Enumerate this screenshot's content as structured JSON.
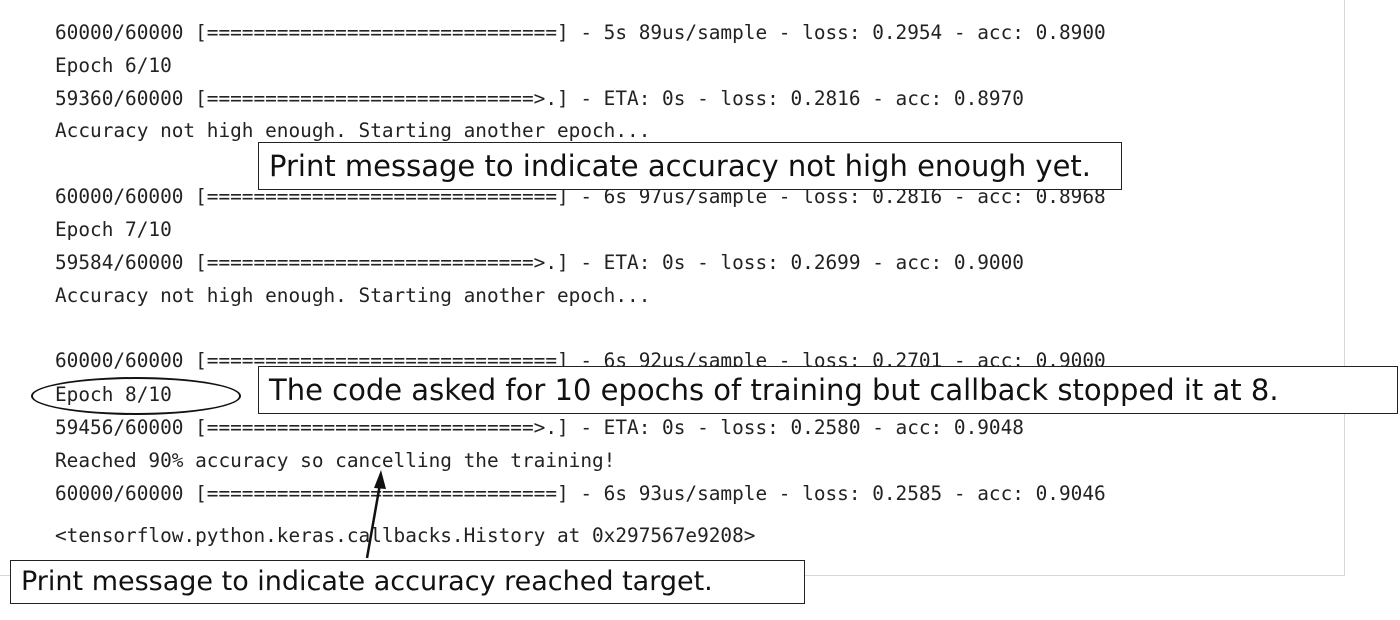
{
  "console": {
    "lines": [
      "60000/60000 [==============================] - 5s 89us/sample - loss: 0.2954 - acc: 0.8900",
      "Epoch 6/10",
      "59360/60000 [============================>.] - ETA: 0s - loss: 0.2816 - acc: 0.8970",
      "Accuracy not high enough. Starting another epoch...",
      "60000/60000 [==============================] - 6s 97us/sample - loss: 0.2816 - acc: 0.8968",
      "Epoch 7/10",
      "59584/60000 [============================>.] - ETA: 0s - loss: 0.2699 - acc: 0.9000",
      "Accuracy not high enough. Starting another epoch...",
      "60000/60000 [==============================] - 6s 92us/sample - loss: 0.2701 - acc: 0.9000",
      "Epoch 8/10",
      "59456/60000 [============================>.] - ETA: 0s - loss: 0.2580 - acc: 0.9048",
      "Reached 90% accuracy so cancelling the training!",
      "60000/60000 [==============================] - 6s 93us/sample - loss: 0.2585 - acc: 0.9046",
      "<tensorflow.python.keras.callbacks.History at 0x297567e9208>"
    ]
  },
  "annotations": {
    "accuracy_not_enough": "Print message to indicate accuracy not high enough yet.",
    "callback_stopped": "The code asked for 10 epochs of training but callback stopped it at 8.",
    "accuracy_reached": "Print message to indicate accuracy reached target."
  }
}
